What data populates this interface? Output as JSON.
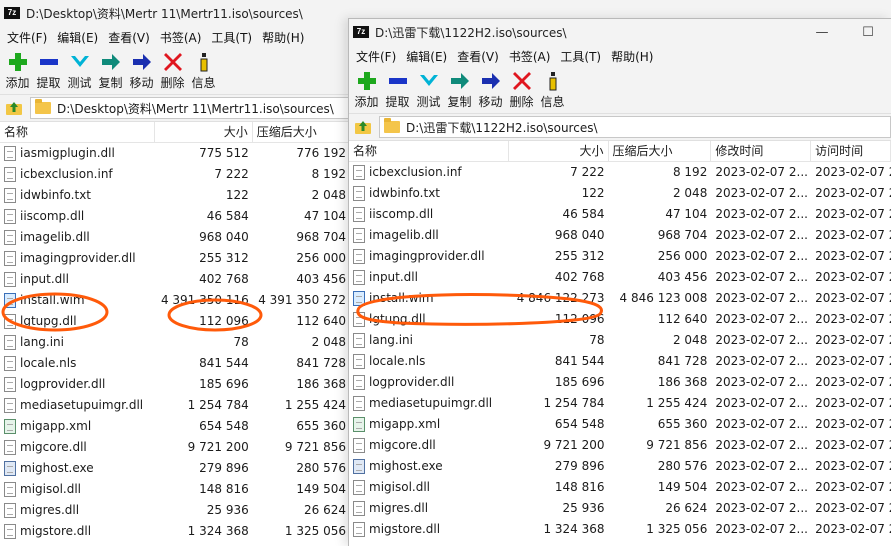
{
  "left": {
    "title": "D:\\Desktop\\资料\\Mertr 11\\Mertr11.iso\\sources\\",
    "path": "D:\\Desktop\\资料\\Mertr 11\\Mertr11.iso\\sources\\",
    "columns": {
      "name": "名称",
      "size": "大小",
      "packed": "压缩后大小"
    },
    "rows": [
      {
        "name": "iasmigplugin.dll",
        "size": "775 512",
        "packed": "776 192",
        "icon": "dll-file-icon"
      },
      {
        "name": "icbexclusion.inf",
        "size": "7 222",
        "packed": "8 192",
        "icon": "inf-file-icon"
      },
      {
        "name": "idwbinfo.txt",
        "size": "122",
        "packed": "2 048",
        "icon": "txt-file-icon"
      },
      {
        "name": "iiscomp.dll",
        "size": "46 584",
        "packed": "47 104",
        "icon": "dll-file-icon"
      },
      {
        "name": "imagelib.dll",
        "size": "968 040",
        "packed": "968 704",
        "icon": "dll-file-icon"
      },
      {
        "name": "imagingprovider.dll",
        "size": "255 312",
        "packed": "256 000",
        "icon": "dll-file-icon"
      },
      {
        "name": "input.dll",
        "size": "402 768",
        "packed": "403 456",
        "icon": "dll-file-icon"
      },
      {
        "name": "install.wim",
        "size": "4 391 350 116",
        "packed": "4 391 350 272",
        "icon": "wim-file-icon"
      },
      {
        "name": "lgtupg.dll",
        "size": "112 096",
        "packed": "112 640",
        "icon": "dll-file-icon"
      },
      {
        "name": "lang.ini",
        "size": "78",
        "packed": "2 048",
        "icon": "ini-file-icon"
      },
      {
        "name": "locale.nls",
        "size": "841 544",
        "packed": "841 728",
        "icon": "nls-file-icon"
      },
      {
        "name": "logprovider.dll",
        "size": "185 696",
        "packed": "186 368",
        "icon": "dll-file-icon"
      },
      {
        "name": "mediasetupuimgr.dll",
        "size": "1 254 784",
        "packed": "1 255 424",
        "icon": "dll-file-icon"
      },
      {
        "name": "migapp.xml",
        "size": "654 548",
        "packed": "655 360",
        "icon": "xml-file-icon"
      },
      {
        "name": "migcore.dll",
        "size": "9 721 200",
        "packed": "9 721 856",
        "icon": "dll-file-icon"
      },
      {
        "name": "mighost.exe",
        "size": "279 896",
        "packed": "280 576",
        "icon": "exe-file-icon"
      },
      {
        "name": "migisol.dll",
        "size": "148 816",
        "packed": "149 504",
        "icon": "dll-file-icon"
      },
      {
        "name": "migres.dll",
        "size": "25 936",
        "packed": "26 624",
        "icon": "dll-file-icon"
      },
      {
        "name": "migstore.dll",
        "size": "1 324 368",
        "packed": "1 325 056",
        "icon": "dll-file-icon"
      }
    ]
  },
  "right": {
    "title": "D:\\迅雷下载\\1122H2.iso\\sources\\",
    "path": "D:\\迅雷下载\\1122H2.iso\\sources\\",
    "columns": {
      "name": "名称",
      "size": "大小",
      "packed": "压缩后大小",
      "modified": "修改时间",
      "accessed": "访问时间"
    },
    "rows": [
      {
        "name": "icbexclusion.inf",
        "size": "7 222",
        "packed": "8 192",
        "modified": "2023-02-07 2...",
        "accessed": "2023-02-07 2...",
        "icon": "inf-file-icon"
      },
      {
        "name": "idwbinfo.txt",
        "size": "122",
        "packed": "2 048",
        "modified": "2023-02-07 2...",
        "accessed": "2023-02-07 2...",
        "icon": "txt-file-icon"
      },
      {
        "name": "iiscomp.dll",
        "size": "46 584",
        "packed": "47 104",
        "modified": "2023-02-07 2...",
        "accessed": "2023-02-07 2...",
        "icon": "dll-file-icon"
      },
      {
        "name": "imagelib.dll",
        "size": "968 040",
        "packed": "968 704",
        "modified": "2023-02-07 2...",
        "accessed": "2023-02-07 2...",
        "icon": "dll-file-icon"
      },
      {
        "name": "imagingprovider.dll",
        "size": "255 312",
        "packed": "256 000",
        "modified": "2023-02-07 2...",
        "accessed": "2023-02-07 2...",
        "icon": "dll-file-icon"
      },
      {
        "name": "input.dll",
        "size": "402 768",
        "packed": "403 456",
        "modified": "2023-02-07 2...",
        "accessed": "2023-02-07 2...",
        "icon": "dll-file-icon"
      },
      {
        "name": "install.wim",
        "size": "4 846 122 273",
        "packed": "4 846 123 008",
        "modified": "2023-02-07 2...",
        "accessed": "2023-02-07 2...",
        "icon": "wim-file-icon"
      },
      {
        "name": "lgtupg.dll",
        "size": "112 096",
        "packed": "112 640",
        "modified": "2023-02-07 2...",
        "accessed": "2023-02-07 2...",
        "icon": "dll-file-icon"
      },
      {
        "name": "lang.ini",
        "size": "78",
        "packed": "2 048",
        "modified": "2023-02-07 2...",
        "accessed": "2023-02-07 2...",
        "icon": "ini-file-icon"
      },
      {
        "name": "locale.nls",
        "size": "841 544",
        "packed": "841 728",
        "modified": "2023-02-07 2...",
        "accessed": "2023-02-07 2...",
        "icon": "nls-file-icon"
      },
      {
        "name": "logprovider.dll",
        "size": "185 696",
        "packed": "186 368",
        "modified": "2023-02-07 2...",
        "accessed": "2023-02-07 2...",
        "icon": "dll-file-icon"
      },
      {
        "name": "mediasetupuimgr.dll",
        "size": "1 254 784",
        "packed": "1 255 424",
        "modified": "2023-02-07 2...",
        "accessed": "2023-02-07 2...",
        "icon": "dll-file-icon"
      },
      {
        "name": "migapp.xml",
        "size": "654 548",
        "packed": "655 360",
        "modified": "2023-02-07 2...",
        "accessed": "2023-02-07 2...",
        "icon": "xml-file-icon"
      },
      {
        "name": "migcore.dll",
        "size": "9 721 200",
        "packed": "9 721 856",
        "modified": "2023-02-07 2...",
        "accessed": "2023-02-07 2...",
        "icon": "dll-file-icon"
      },
      {
        "name": "mighost.exe",
        "size": "279 896",
        "packed": "280 576",
        "modified": "2023-02-07 2...",
        "accessed": "2023-02-07 2...",
        "icon": "exe-file-icon"
      },
      {
        "name": "migisol.dll",
        "size": "148 816",
        "packed": "149 504",
        "modified": "2023-02-07 2...",
        "accessed": "2023-02-07 2...",
        "icon": "dll-file-icon"
      },
      {
        "name": "migres.dll",
        "size": "25 936",
        "packed": "26 624",
        "modified": "2023-02-07 2...",
        "accessed": "2023-02-07 2...",
        "icon": "dll-file-icon"
      },
      {
        "name": "migstore.dll",
        "size": "1 324 368",
        "packed": "1 325 056",
        "modified": "2023-02-07 2...",
        "accessed": "2023-02-07 2...",
        "icon": "dll-file-icon"
      }
    ]
  },
  "app": {
    "icon_text": "7z"
  },
  "menu": [
    "文件(F)",
    "编辑(E)",
    "查看(V)",
    "书签(A)",
    "工具(T)",
    "帮助(H)"
  ],
  "toolbar": [
    {
      "label": "添加",
      "icon": "add-icon",
      "color": "#1ea81e"
    },
    {
      "label": "提取",
      "icon": "extract-icon",
      "color": "#1a35c8"
    },
    {
      "label": "测试",
      "icon": "test-icon",
      "color": "#00b3d6"
    },
    {
      "label": "复制",
      "icon": "copy-icon",
      "color": "#0f8a7a"
    },
    {
      "label": "移动",
      "icon": "move-icon",
      "color": "#1a2fb0"
    },
    {
      "label": "删除",
      "icon": "delete-icon",
      "color": "#e0161f"
    },
    {
      "label": "信息",
      "icon": "info-icon",
      "color": "#e8c000"
    }
  ],
  "window_buttons": {
    "minimize": "—",
    "maximize": "☐"
  },
  "annotation_color": "#ff5a0a"
}
